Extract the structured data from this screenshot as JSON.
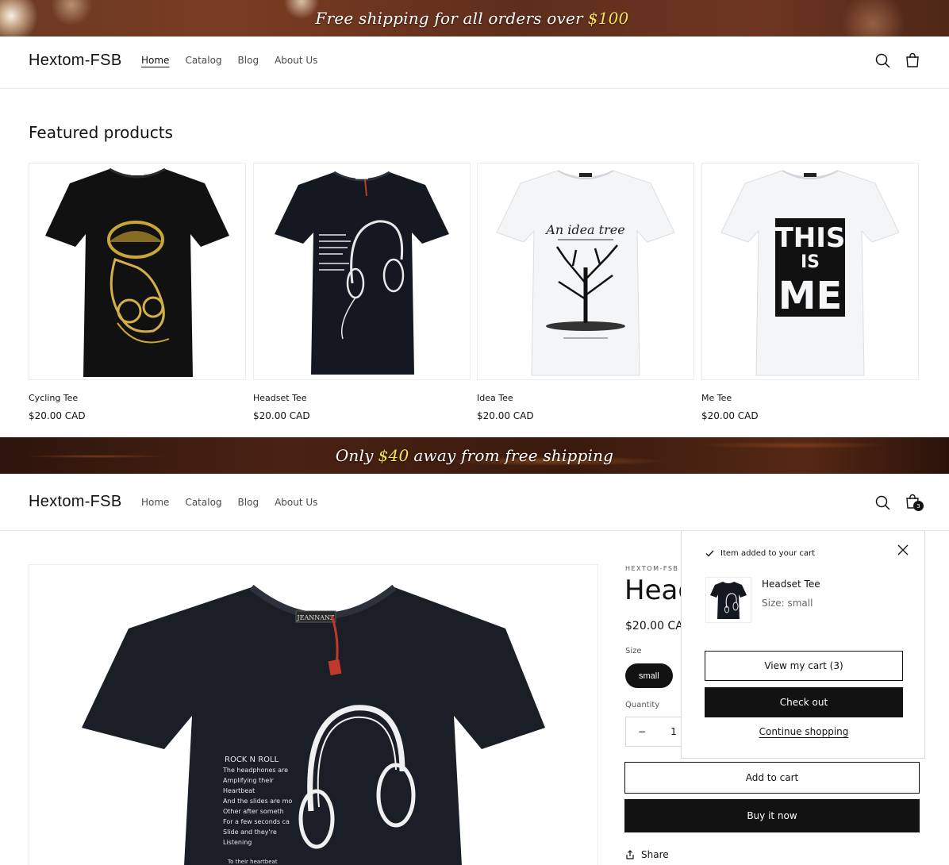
{
  "top_banner": {
    "prefix": "Free shipping for all orders over",
    "amount": "$100"
  },
  "header1": {
    "logo": "Hextom-FSB",
    "nav": [
      "Home",
      "Catalog",
      "Blog",
      "About Us"
    ]
  },
  "featured": {
    "title": "Featured products",
    "products": [
      {
        "name": "Cycling Tee",
        "price": "$20.00 CAD",
        "shirt_color": "#111111",
        "print": "gold-cap-figure"
      },
      {
        "name": "Headset Tee",
        "price": "$20.00 CAD",
        "shirt_color": "#141821",
        "print": "headphones"
      },
      {
        "name": "Idea Tee",
        "price": "$20.00 CAD",
        "shirt_color": "#f4f5f7",
        "print": "An idea tree"
      },
      {
        "name": "Me Tee",
        "price": "$20.00 CAD",
        "shirt_color": "#f4f5f7",
        "print": "THIS IS ME"
      }
    ]
  },
  "mid_banner": {
    "prefix": "Only",
    "amount": "$40",
    "suffix": "away from free shipping"
  },
  "header2": {
    "logo": "Hextom-FSB",
    "nav": [
      "Home",
      "Catalog",
      "Blog",
      "About Us"
    ],
    "cart_count": "3"
  },
  "product": {
    "vendor": "HEXTOM-FSB",
    "title_partial": "Head",
    "price_partial": "$20.00 CA",
    "size_label": "Size",
    "size_selected": "small",
    "quantity_label": "Quantity",
    "quantity_minus": "−",
    "quantity_value": "1",
    "add_to_cart": "Add to cart",
    "buy_now": "Buy it now",
    "share": "Share",
    "print_text": {
      "brand": "JEANNANZ",
      "heading": "ROCK N ROLL",
      "lines": [
        "The headphones are",
        "Amplifying their",
        "Heartbeat",
        "And the slides are mo",
        "Other after someth",
        "For a few seconds ca",
        "Slide and they're",
        "Listening"
      ],
      "footer": "To their heartbeat"
    }
  },
  "cart_popup": {
    "added_text": "Item added to your cart",
    "item_name": "Headset Tee",
    "item_size": "Size: small",
    "view_cart": "View my cart (3)",
    "checkout": "Check out",
    "continue": "Continue shopping"
  },
  "colors": {
    "accent": "#f5e15a",
    "dark": "#121212"
  }
}
